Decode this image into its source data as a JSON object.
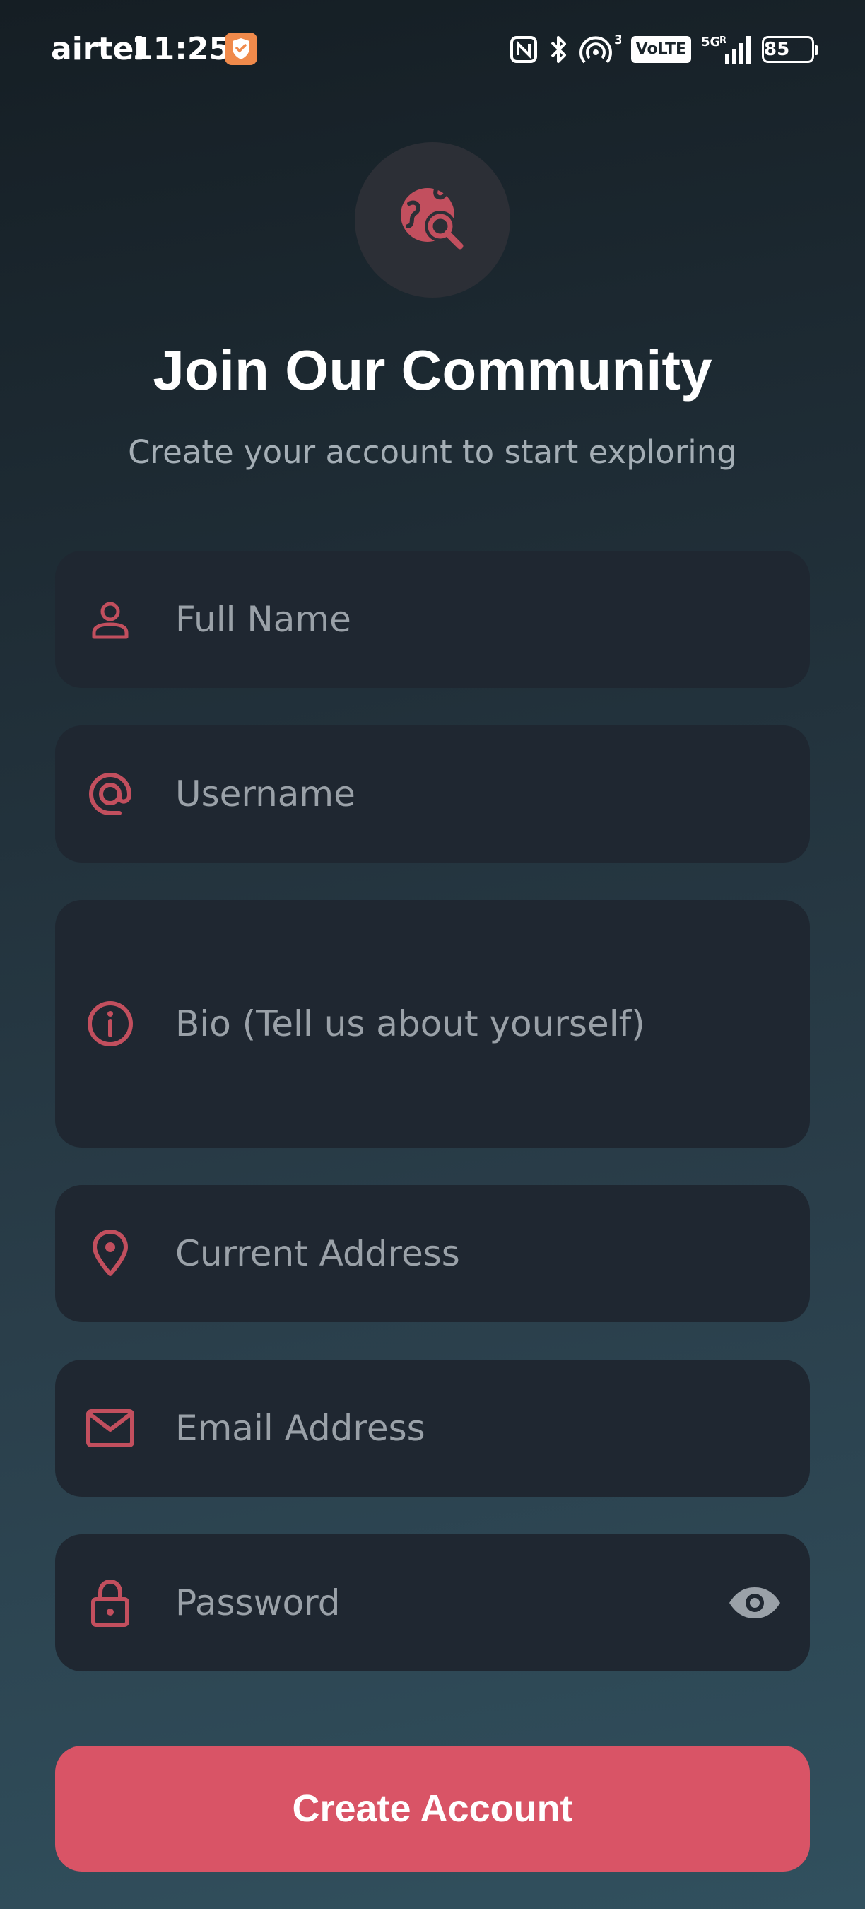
{
  "status_bar": {
    "carrier": "airtel",
    "time": "11:25",
    "network_type": "VoLTE",
    "network_gen": "5G",
    "network_extra": "R",
    "hotspot_count": "3",
    "battery": "85",
    "icons": [
      "nfc-icon",
      "bluetooth-icon",
      "hotspot-icon",
      "volte-icon",
      "signal-icon",
      "battery-icon"
    ]
  },
  "header": {
    "logo_icon": "globe-search-icon",
    "title": "Join Our Community",
    "subtitle": "Create your account to start exploring"
  },
  "form": {
    "fields": [
      {
        "icon": "person-icon",
        "placeholder": "Full Name",
        "value": ""
      },
      {
        "icon": "at-sign-icon",
        "placeholder": "Username",
        "value": ""
      },
      {
        "icon": "info-icon",
        "placeholder": "Bio (Tell us about yourself)",
        "value": ""
      },
      {
        "icon": "location-pin-icon",
        "placeholder": "Current Address",
        "value": ""
      },
      {
        "icon": "mail-icon",
        "placeholder": "Email Address",
        "value": ""
      },
      {
        "icon": "lock-icon",
        "placeholder": "Password",
        "value": "",
        "toggle_icon": "eye-icon"
      }
    ],
    "submit_label": "Create Account"
  },
  "colors": {
    "accent": "#d95466",
    "icon": "#c24f5e",
    "field_bg": "#1f2731",
    "placeholder": "#9aa1a8",
    "subtitle": "#a4aeb5"
  }
}
